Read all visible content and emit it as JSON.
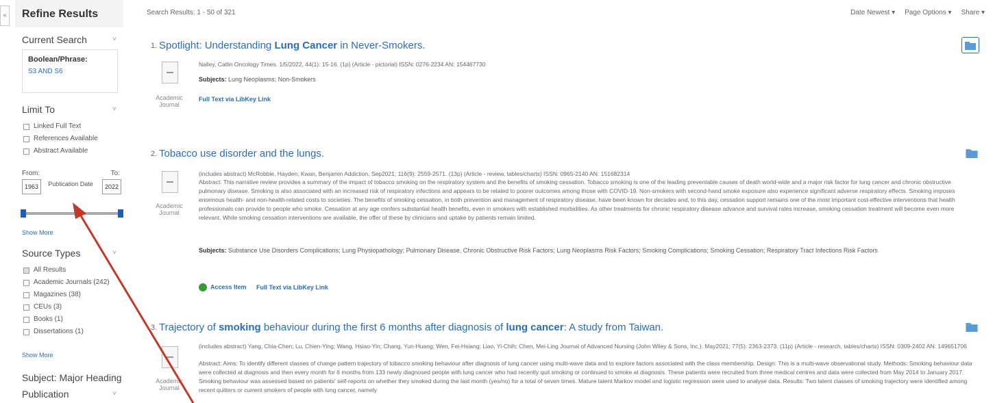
{
  "sidebar": {
    "collapse": "«",
    "refine_title": "Refine Results",
    "current_search": {
      "heading": "Current Search",
      "bp_label": "Boolean/Phrase:",
      "bp_value": "S3 AND S6"
    },
    "limit_to": {
      "heading": "Limit To",
      "options": [
        "Linked Full Text",
        "References Available",
        "Abstract Available"
      ]
    },
    "date": {
      "from_label": "From:",
      "to_label": "To:",
      "from_value": "1963",
      "to_value": "2022",
      "pub_label": "Publication Date"
    },
    "show_more": "Show More",
    "source_types": {
      "heading": "Source Types",
      "options": [
        "All Results",
        "Academic Journals (242)",
        "Magazines (38)",
        "CEUs (3)",
        "Books (1)",
        "Dissertations (1)"
      ]
    },
    "subject_major": "Subject: Major Heading",
    "publication": "Publication",
    "caret": "˅"
  },
  "header": {
    "results_count": "Search Results: 1 - 50 of 321",
    "sort": "Date Newest ▾",
    "page_options": "Page Options ▾",
    "share": "Share ▾"
  },
  "results": [
    {
      "num": "1.",
      "title_pre": "Spotlight: Understanding ",
      "title_bold": "Lung Cancer",
      "title_post": " in Never-Smokers.",
      "meta": "Nalley, Catlin Oncology Times. 1/5/2022, 44(1): 15-16. (1p) (Article - pictorial) ISSN: 0276-2234 AN: 154467730",
      "subjects_label": "Subjects:",
      "subjects_text": "Lung Neoplasms; Non-Smokers",
      "doc_type": "Academic Journal",
      "fulltext": "Full Text via LibKey Link"
    },
    {
      "num": "2.",
      "title": "Tobacco use disorder and the lungs.",
      "meta": "(includes abstract) McRobbie, Hayden; Kwan, Benjamin Addiction. Sep2021; 116(9): 2559-2571. (13p) (Article - review, tables/charts) ISSN: 0965-2140 AN: 151682314",
      "abstract": "Abstract: This narrative review provides a summary of the impact of tobacco smoking on the respiratory system and the benefits of smoking cessation. Tobacco smoking is one of the leading preventable causes of death world-wide and a major risk factor for lung cancer and chronic obstructive pulmonary disease. Smoking is also associated with an increased risk of respiratory infections and appears to be related to poorer outcomes among those with COVID-19. Non-smokers with second-hand smoke exposure also experience significant adverse respiratory effects. Smoking imposes enormous health- and non-health-related costs to societies. The benefits of smoking cessation, in both prevention and management of respiratory disease, have been known for decades and, to this day, cessation support remains one of the most important cost-effective interventions that health professionals can provide to people who smoke. Cessation at any age confers substantial health benefits, even in smokers with established morbidities. As other treatments for chronic respiratory disease advance and survival rates increase, smoking cessation treatment will become even more relevant. While smoking cessation interventions are available, the offer of these by clinicians and uptake by patients remain limited.",
      "subjects_label": "Subjects:",
      "subjects_text": "Substance Use Disorders Complications; Lung Physiopathology; Pulmonary Disease, Chronic Obstructive Risk Factors; Lung Neoplasms Risk Factors; Smoking Complications; Smoking Cessation; Respiratory Tract Infections Risk Factors",
      "doc_type": "Academic Journal",
      "access": "Access Item",
      "fulltext": "Full Text via LibKey Link"
    },
    {
      "num": "3.",
      "title_pre": "Trajectory of ",
      "title_bold": "smoking",
      "title_mid": " behaviour during the first 6 months after diagnosis of ",
      "title_bold2": "lung cancer",
      "title_post": ": A study from Taiwan.",
      "meta": "(includes abstract) Yang, Chia-Chen; Lu, Chien-Ying; Wang, Hsiao-Yin; Chang, Yun-Huang; Wen, Fei-Hsiang; Liao, Yi-Chih; Chen, Mei-Ling Journal of Advanced Nursing (John Wiley & Sons, Inc.). May2021; 77(5): 2363-2373. (11p) (Article - research, tables/charts) ISSN: 0309-2402 AN: 149651706",
      "abstract": "Abstract: Aims: To identify different classes of change pattern trajectory of tobacco smoking behaviour after diagnosis of lung cancer using multi-wave data and to explore factors associated with the class membership. Design: This is a multi-wave observational study. Methods: Smoking behaviour data were collected at diagnosis and then every month for 6 months from 133 newly diagnosed people with lung cancer who had recently quit smoking or continued to smoke at diagnosis. These patients were recruited from three medical centres and data were collected from May 2014 to January 2017. Smoking behaviour was assessed based on patients' self-reports on whether they smoked during the last month (yes/no) for a total of seven times. Mature latent Markov model and logistic regression were used to analyse data. Results: Two latent classes of smoking trajectory were identified among recent quitters or current smokers of people with lung cancer, namely",
      "doc_type": "Academic Journal"
    }
  ],
  "colors": {
    "link": "#2a6eb8",
    "slider": "#1e5fb4",
    "arrow": "#c0392b"
  }
}
